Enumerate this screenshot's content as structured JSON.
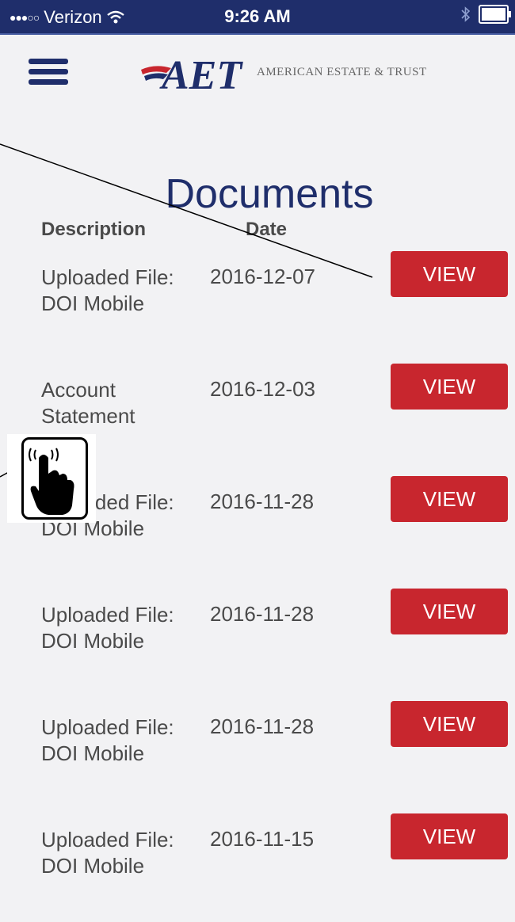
{
  "status_bar": {
    "carrier": "Verizon",
    "time": "9:26 AM"
  },
  "header": {
    "logo_text": "AET",
    "brand": "AMERICAN ESTATE & TRUST"
  },
  "page_title": "Documents",
  "table": {
    "columns": [
      "Description",
      "Date"
    ],
    "rows": [
      {
        "description": "Uploaded File: DOI Mobile",
        "date": "2016-12-07",
        "action": "VIEW"
      },
      {
        "description": "Account Statement",
        "date": "2016-12-03",
        "action": "VIEW"
      },
      {
        "description": "Uploaded File: DOI Mobile",
        "date": "2016-11-28",
        "action": "VIEW"
      },
      {
        "description": "Uploaded File: DOI Mobile",
        "date": "2016-11-28",
        "action": "VIEW"
      },
      {
        "description": "Uploaded File: DOI Mobile",
        "date": "2016-11-28",
        "action": "VIEW"
      },
      {
        "description": "Uploaded File: DOI Mobile",
        "date": "2016-11-15",
        "action": "VIEW"
      }
    ]
  },
  "colors": {
    "brand_navy": "#1f2e6b",
    "view_red": "#c8262e",
    "background": "#f2f2f4"
  },
  "icons": [
    "menu-icon",
    "wifi-icon",
    "bluetooth-icon",
    "battery-icon",
    "tap-hand-icon"
  ]
}
